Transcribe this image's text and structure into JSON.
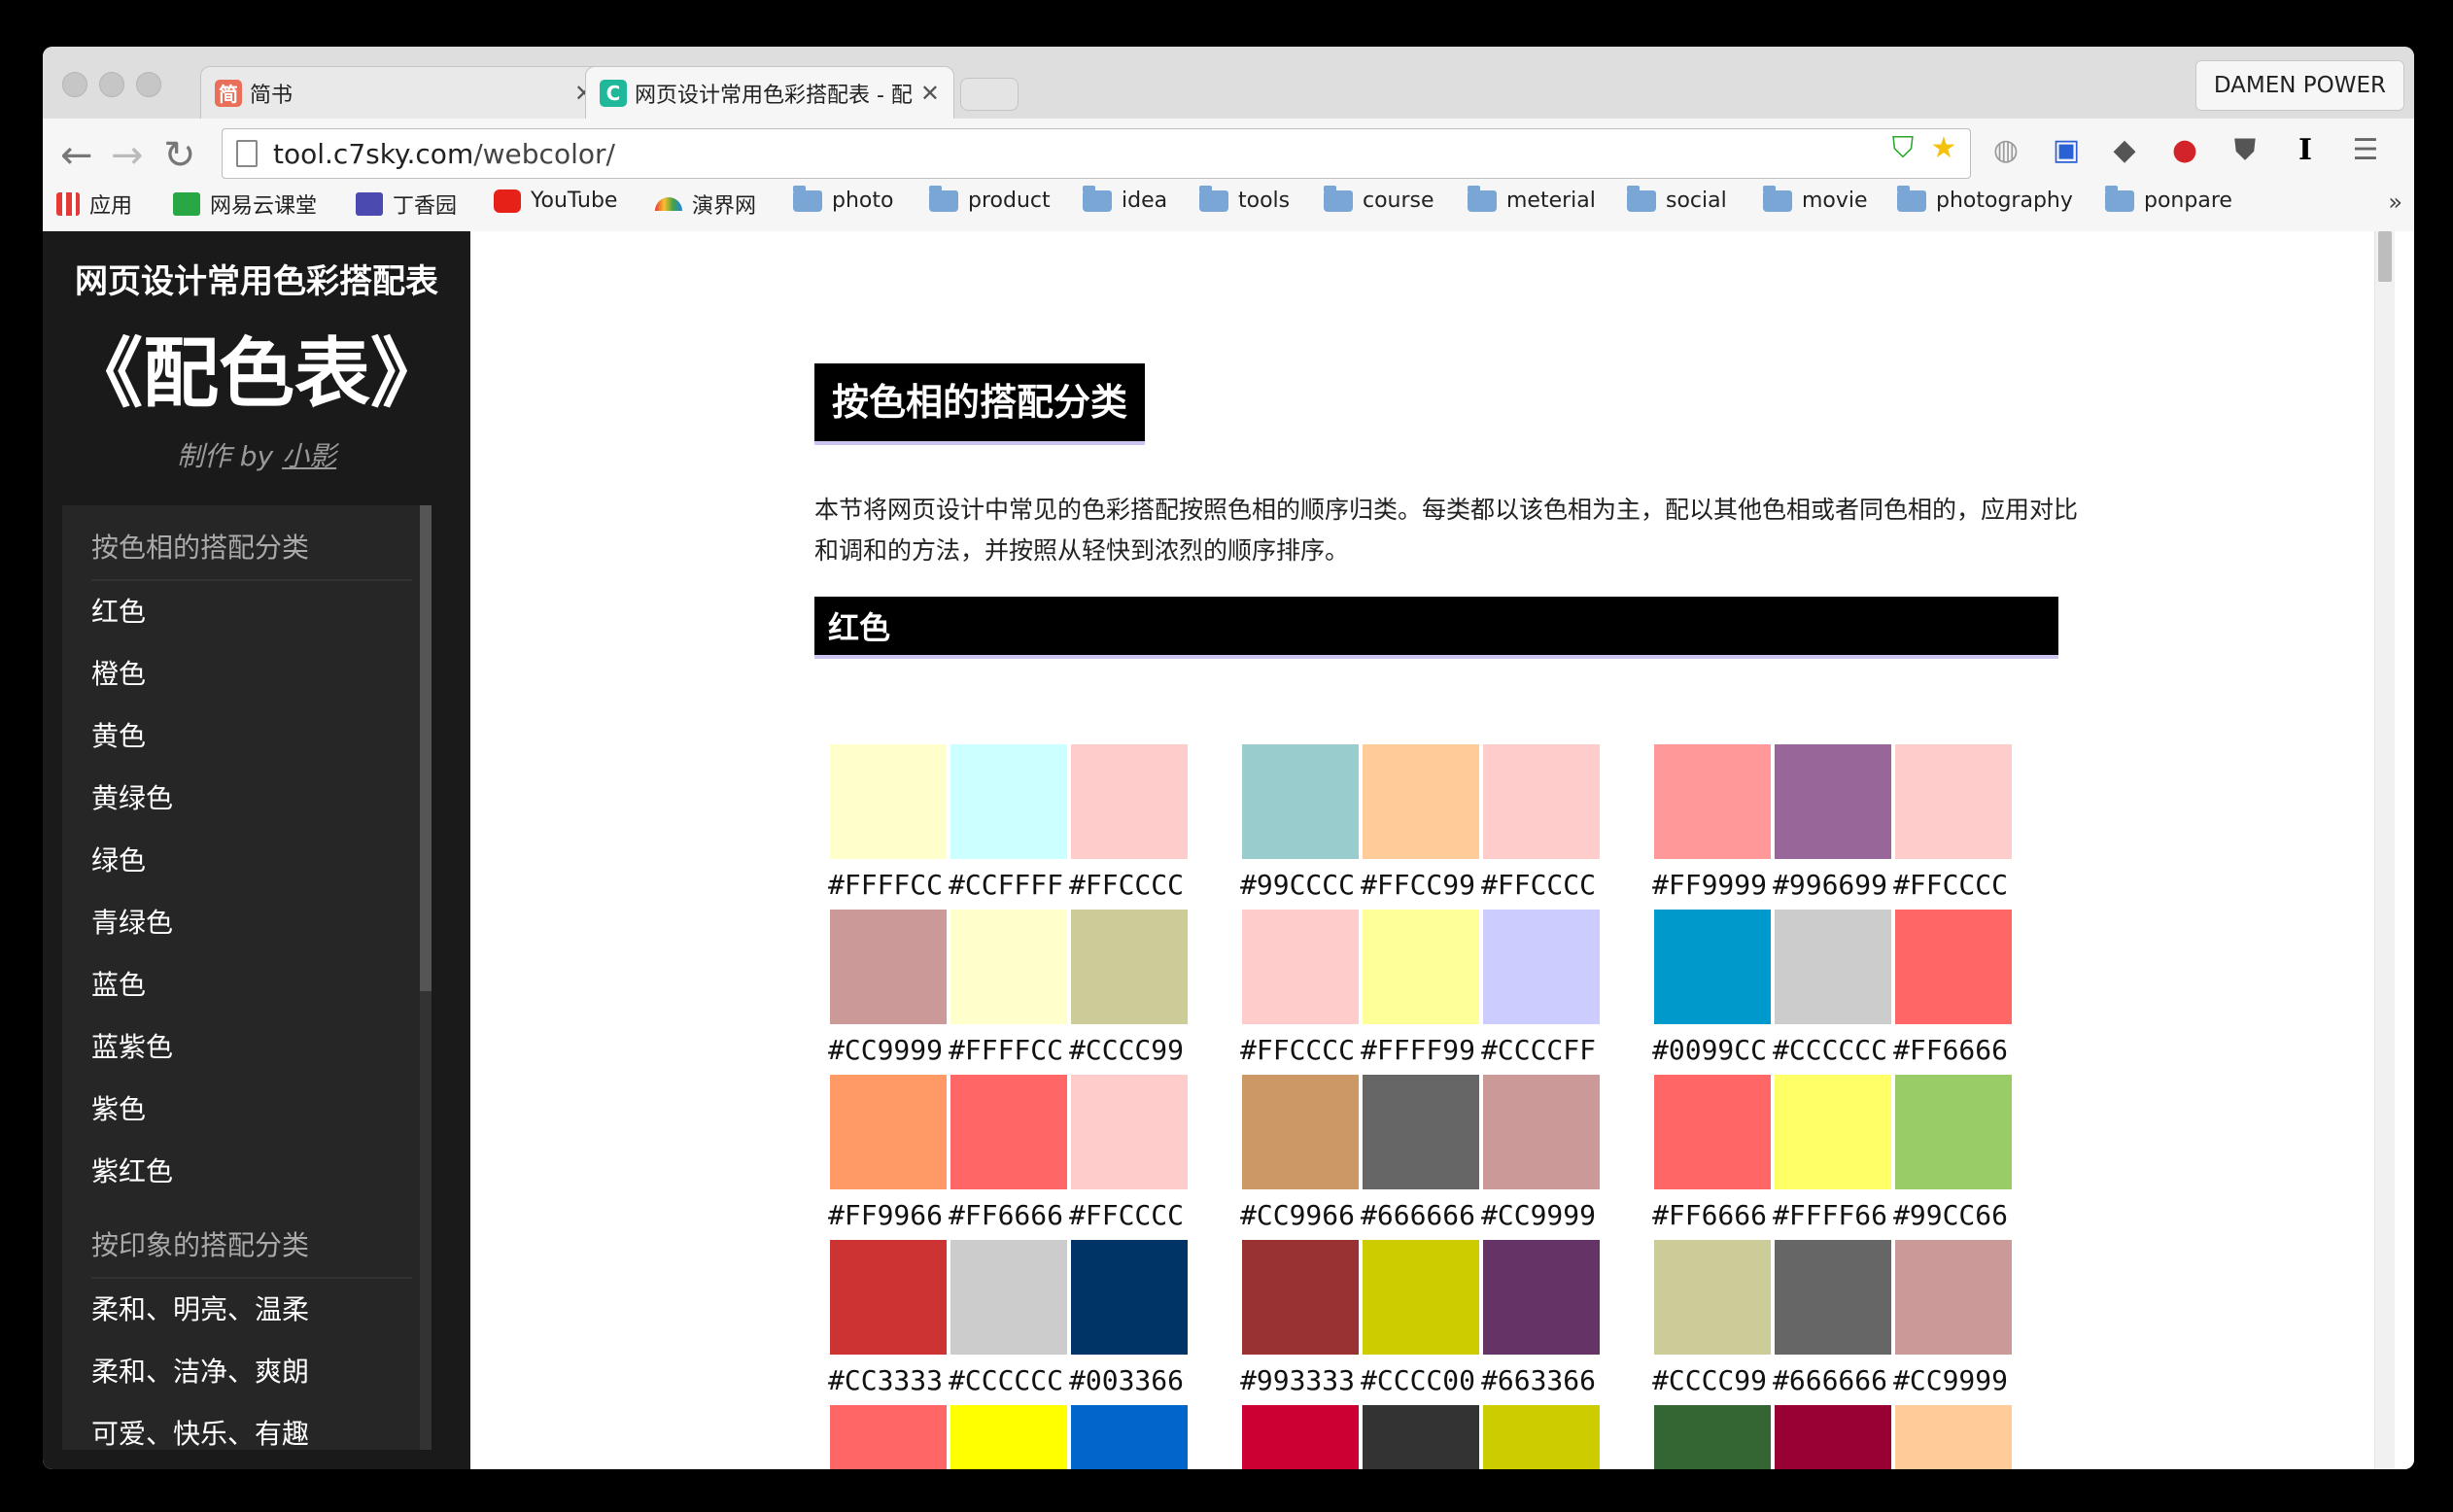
{
  "browser": {
    "tabs": [
      {
        "label": "简书",
        "favicon_char": "简",
        "favicon_color": "#ea6f5a"
      },
      {
        "label": "网页设计常用色彩搭配表 - 配",
        "favicon_char": "C",
        "favicon_color": "#1fb89a"
      }
    ],
    "profile": "DAMEN POWER",
    "url_host": "tool.c7sky.com",
    "url_path": "/webcolor/",
    "bookmarks": [
      {
        "label": "应用",
        "icon": "apps-icon"
      },
      {
        "label": "网易云课堂",
        "icon": "netease-icon"
      },
      {
        "label": "丁香园",
        "icon": "dxy-icon"
      },
      {
        "label": "YouTube",
        "icon": "youtube-icon"
      },
      {
        "label": "演界网",
        "icon": "yanjie-icon"
      },
      {
        "label": "photo",
        "icon": "folder-icon"
      },
      {
        "label": "product",
        "icon": "folder-icon"
      },
      {
        "label": "idea",
        "icon": "folder-icon"
      },
      {
        "label": "tools",
        "icon": "folder-icon"
      },
      {
        "label": "course",
        "icon": "folder-icon"
      },
      {
        "label": "meterial",
        "icon": "folder-icon"
      },
      {
        "label": "social",
        "icon": "folder-icon"
      },
      {
        "label": "movie",
        "icon": "folder-icon"
      },
      {
        "label": "photography",
        "icon": "folder-icon"
      },
      {
        "label": "ponpare",
        "icon": "folder-icon"
      }
    ],
    "more_bookmarks": "»"
  },
  "sidebar": {
    "title_line1": "网页设计常用色彩搭配表",
    "title_line2": "《配色表》",
    "credit_prefix": "制作 by ",
    "credit_author": "小影",
    "menu": [
      {
        "label": "按色相的搭配分类",
        "type": "head"
      },
      {
        "label": "红色",
        "type": "item"
      },
      {
        "label": "橙色",
        "type": "item"
      },
      {
        "label": "黄色",
        "type": "item"
      },
      {
        "label": "黄绿色",
        "type": "item"
      },
      {
        "label": "绿色",
        "type": "item"
      },
      {
        "label": "青绿色",
        "type": "item"
      },
      {
        "label": "蓝色",
        "type": "item"
      },
      {
        "label": "蓝紫色",
        "type": "item"
      },
      {
        "label": "紫色",
        "type": "item"
      },
      {
        "label": "紫红色",
        "type": "item"
      },
      {
        "label": "按印象的搭配分类",
        "type": "head"
      },
      {
        "label": "柔和、明亮、温柔",
        "type": "item"
      },
      {
        "label": "柔和、洁净、爽朗",
        "type": "item"
      },
      {
        "label": "可爱、快乐、有趣",
        "type": "item"
      }
    ]
  },
  "main": {
    "heading": "按色相的搭配分类",
    "intro": "本节将网页设计中常见的色彩搭配按照色相的顺序归类。每类都以该色相为主，配以其他色相或者同色相的，应用对比和调和的方法，并按照从轻快到浓烈的顺序排序。",
    "section": "红色",
    "palette_rows": [
      [
        [
          "#FFFFCC",
          "#CCFFFF",
          "#FFCCCC"
        ],
        [
          "#99CCCC",
          "#FFCC99",
          "#FFCCCC"
        ],
        [
          "#FF9999",
          "#996699",
          "#FFCCCC"
        ]
      ],
      [
        [
          "#CC9999",
          "#FFFFCC",
          "#CCCC99"
        ],
        [
          "#FFCCCC",
          "#FFFF99",
          "#CCCCFF"
        ],
        [
          "#0099CC",
          "#CCCCCC",
          "#FF6666"
        ]
      ],
      [
        [
          "#FF9966",
          "#FF6666",
          "#FFCCCC"
        ],
        [
          "#CC9966",
          "#666666",
          "#CC9999"
        ],
        [
          "#FF6666",
          "#FFFF66",
          "#99CC66"
        ]
      ],
      [
        [
          "#CC3333",
          "#CCCCCC",
          "#003366"
        ],
        [
          "#993333",
          "#CCCC00",
          "#663366"
        ],
        [
          "#CCCC99",
          "#666666",
          "#CC9999"
        ]
      ],
      [
        [
          "#FF6666",
          "#FFFF00",
          "#0066CC"
        ],
        [
          "#CC0033",
          "#333333",
          "#CCCC00"
        ],
        [
          "#336633",
          "#990033",
          "#FFCC99"
        ]
      ]
    ]
  }
}
